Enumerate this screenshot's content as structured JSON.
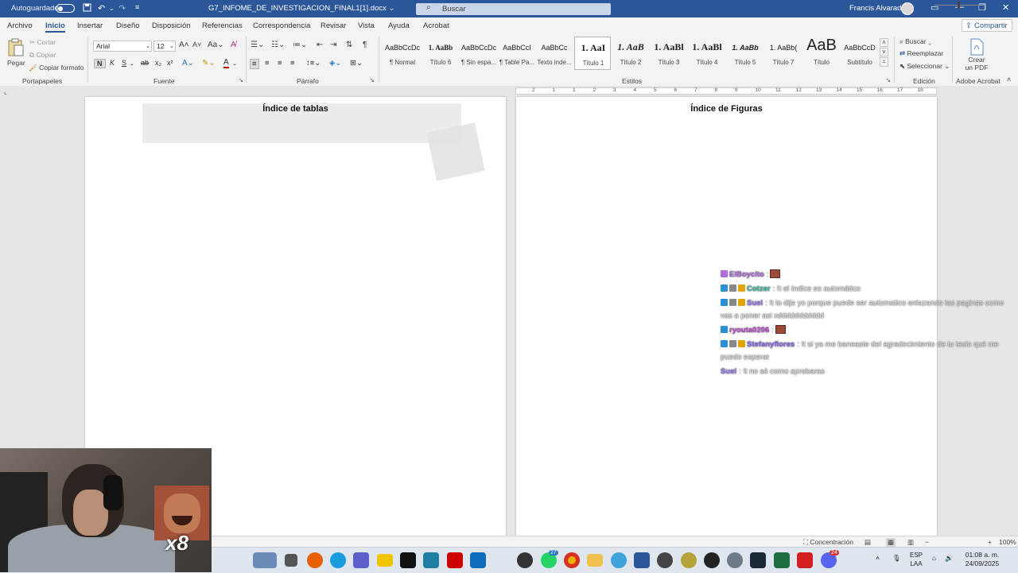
{
  "titlebar": {
    "autosave_label": "Autoguardado",
    "document_name": "G7_INFOME_DE_INVESTIGACION_FINAL1[1].docx",
    "search_placeholder": "Buscar",
    "user_name": "Francis Alvarado"
  },
  "menu": {
    "tabs": [
      "Archivo",
      "Inicio",
      "Insertar",
      "Diseño",
      "Disposición",
      "Referencias",
      "Correspondencia",
      "Revisar",
      "Vista",
      "Ayuda",
      "Acrobat"
    ],
    "active_tab": "Inicio",
    "share_label": "Compartir"
  },
  "ribbon": {
    "clipboard": {
      "paste": "Pegar",
      "cut": "Cortar",
      "copy": "Copiar",
      "format_painter": "Copiar formato",
      "group_label": "Portapapeles"
    },
    "font": {
      "font_name": "Arial",
      "font_size": "12",
      "group_label": "Fuente",
      "bold": "N",
      "italic": "K",
      "underline": "S"
    },
    "paragraph": {
      "group_label": "Párrafo"
    },
    "styles": {
      "group_label": "Estilos",
      "items": [
        {
          "preview": "AaBbCcDc",
          "name": "¶ Normal"
        },
        {
          "preview": "1. AaBb",
          "name": "Título 6"
        },
        {
          "preview": "AaBbCcDc",
          "name": "¶ Sin espa..."
        },
        {
          "preview": "AaBbCcI",
          "name": "¶ Table Pa..."
        },
        {
          "preview": "AaBbCc",
          "name": "Texto inde..."
        },
        {
          "preview": "1. AaI",
          "name": "Título 1"
        },
        {
          "preview": "1. AaB",
          "name": "Título 2"
        },
        {
          "preview": "1. AaBl",
          "name": "Título 3"
        },
        {
          "preview": "1. AaBl",
          "name": "Título 4"
        },
        {
          "preview": "1. AaBb",
          "name": "Título 5"
        },
        {
          "preview": "1. AaBb(",
          "name": "Título 7"
        },
        {
          "preview": "AaB",
          "name": "Título"
        },
        {
          "preview": "AaBbCcD",
          "name": "Subtítulo"
        }
      ],
      "selected_index": 5
    },
    "editing": {
      "find": "Buscar",
      "replace": "Reemplazar",
      "select": "Seleccionar",
      "group_label": "Edición"
    },
    "acrobat": {
      "create_pdf_line1": "Crear",
      "create_pdf_line2": "un PDF",
      "group_label": "Adobe Acrobat"
    }
  },
  "ruler": {
    "labels": [
      "2",
      "1",
      "1",
      "2",
      "3",
      "4",
      "5",
      "6",
      "7",
      "8",
      "9",
      "10",
      "11",
      "12",
      "13",
      "14",
      "15",
      "16",
      "17",
      "18"
    ]
  },
  "document": {
    "page1_title": "Índice de tablas",
    "page2_title": "Índice de Figuras"
  },
  "chat": [
    {
      "user": "ElBoycito",
      "color": "#b06cdb",
      "text": ":",
      "emote": true
    },
    {
      "user": "Cotzer",
      "color": "#3fc1a5",
      "text": ": !t el índice es automático"
    },
    {
      "user": "Suel",
      "color": "#9a7bf0",
      "text": ": !t lo dije yo porque puede ser automatico enlazando las paginas como vas a poner asi xddddddddddd"
    },
    {
      "user": "ryouta0206",
      "color": "#c44fd6",
      "text": ":",
      "emote": true
    },
    {
      "user": "Stefanyflores",
      "color": "#8d6ef0",
      "text": ": !t si ya me baneaste del agradecimiento de tu tesis qué me puedo esperar"
    },
    {
      "user": "Suel",
      "color": "#9a7bf0",
      "text": ": !t no sé como aprobaras"
    }
  ],
  "statusbar": {
    "focus_label": "Concentración",
    "zoom": "100%"
  },
  "overlay": {
    "emote_count": "x8"
  },
  "taskbar": {
    "language_line1": "ESP",
    "language_line2": "LAA",
    "time": "01:08 a. m.",
    "date": "24/09/2025",
    "badge_whatsapp": "27",
    "badge_discord": "24"
  },
  "colors": {
    "title_blue": "#2b579a",
    "ribbon_bg": "#f3f3f3",
    "canvas_bg": "#e6e6e6"
  }
}
